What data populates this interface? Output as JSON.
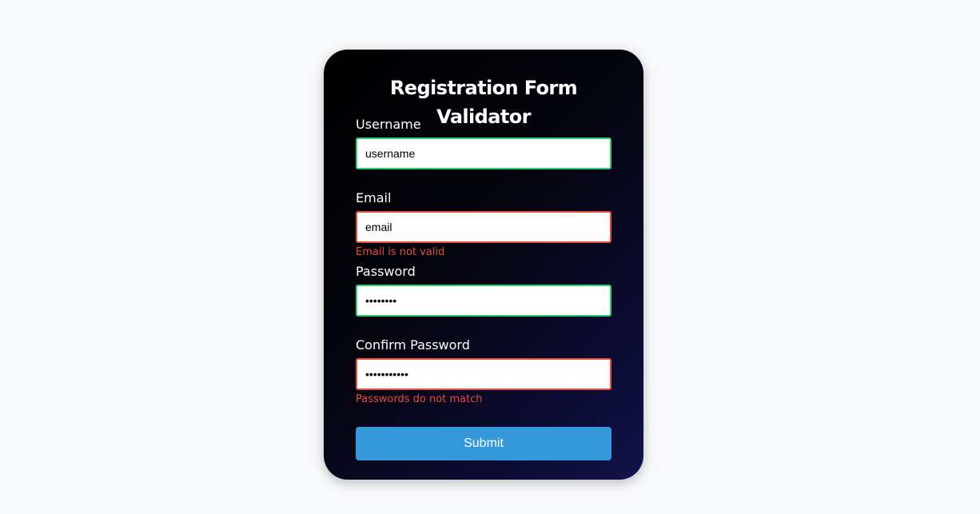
{
  "form": {
    "title": "Registration Form Validator",
    "fields": [
      {
        "label": "Username",
        "value": "username",
        "type": "text",
        "state": "success",
        "message": ""
      },
      {
        "label": "Email",
        "value": "email",
        "type": "text",
        "state": "error",
        "message": "Email is not valid"
      },
      {
        "label": "Password",
        "value": "password",
        "type": "password",
        "state": "success",
        "message": ""
      },
      {
        "label": "Confirm Password",
        "value": "password123",
        "type": "password",
        "state": "error",
        "message": "Passwords do not match"
      }
    ],
    "submit_label": "Submit"
  },
  "colors": {
    "success": "#2ecc71",
    "error": "#e74c3c",
    "button": "#3498db",
    "page_background": "#f8f9fb"
  }
}
